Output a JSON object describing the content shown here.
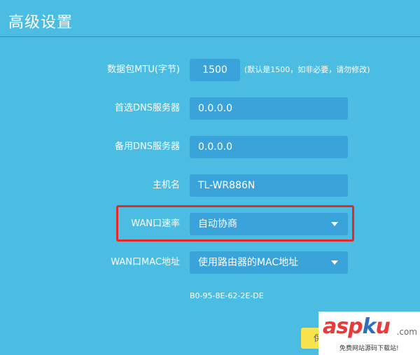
{
  "page": {
    "title": "高级设置"
  },
  "form": {
    "mtu": {
      "label": "数据包MTU(字节)",
      "value": "1500",
      "hint": "(默认是1500，如非必要，请勿修改)"
    },
    "primary_dns": {
      "label": "首选DNS服务器",
      "value": "0.0.0.0"
    },
    "secondary_dns": {
      "label": "备用DNS服务器",
      "value": "0.0.0.0"
    },
    "hostname": {
      "label": "主机名",
      "value": "TL-WR886N"
    },
    "wan_speed": {
      "label": "WAN口速率",
      "selected": "自动协商"
    },
    "wan_mac": {
      "label": "WAN口MAC地址",
      "selected": "使用路由器的MAC地址",
      "mac_value": "B0-95-8E-62-2E-DE"
    }
  },
  "actions": {
    "save_label": "保存"
  },
  "watermark": {
    "logo_a": "asp",
    "logo_b": "k",
    "logo_c": "u",
    "domain_suffix": ".com",
    "tagline": "免费网站源码下载站!"
  },
  "colors": {
    "background": "#4bbde2",
    "field": "#3aa3da",
    "highlight": "#e32a2a",
    "save_button": "#f6e34e"
  }
}
